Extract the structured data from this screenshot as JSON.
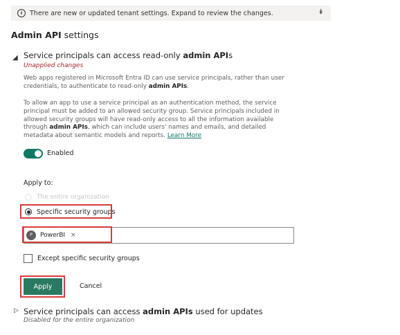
{
  "banner": {
    "text": "There are new or updated tenant settings. Expand to review the changes."
  },
  "section": {
    "title_bold": "Admin API",
    "title_rest": "settings"
  },
  "setting1": {
    "title_prefix": "Service principals can access read-only ",
    "title_bold": "admin API",
    "title_suffix": "s",
    "status": "Unapplied changes",
    "para1_prefix": "Web apps registered in Microsoft Entra ID can use service principals, rather than user credentials, to authenticate to read-only ",
    "para1_bold": "admin APIs",
    "para1_suffix": ".",
    "para2_prefix": "To allow an app to use a service principal as an authentication method, the service principal must be added to an allowed security group. Service principals included in allowed security groups will have read-only access to all the information available through ",
    "para2_bold": "admin APIs",
    "para2_suffix": ", which can include users' names and emails, and detailed metadata about semantic models and reports.",
    "learn_more": "Learn More",
    "toggle_label": "Enabled",
    "toggle_on": true,
    "apply_to_label": "Apply to:",
    "option_entire_org": "The entire organization",
    "option_specific_groups": "Specific security groups",
    "chip_initial": "P",
    "chip_label": "PowerBI",
    "chip_remove": "×",
    "except_label": "Except specific security groups",
    "apply_label": "Apply",
    "cancel_label": "Cancel"
  },
  "setting2": {
    "title_prefix": "Service principals can access ",
    "title_bold": "admin APIs",
    "title_suffix": " used for updates",
    "status": "Disabled for the entire organization"
  },
  "colors": {
    "accent": "#117865",
    "apply_button": "#2a7a63",
    "highlight": "#d83b3b",
    "warning": "#a4262c"
  },
  "icons": {
    "banner_info": "info-icon",
    "banner_expand": "double-chevron-down-icon",
    "setting1_expand": "chevron-expanded-icon",
    "setting2_expand": "chevron-right-icon"
  }
}
